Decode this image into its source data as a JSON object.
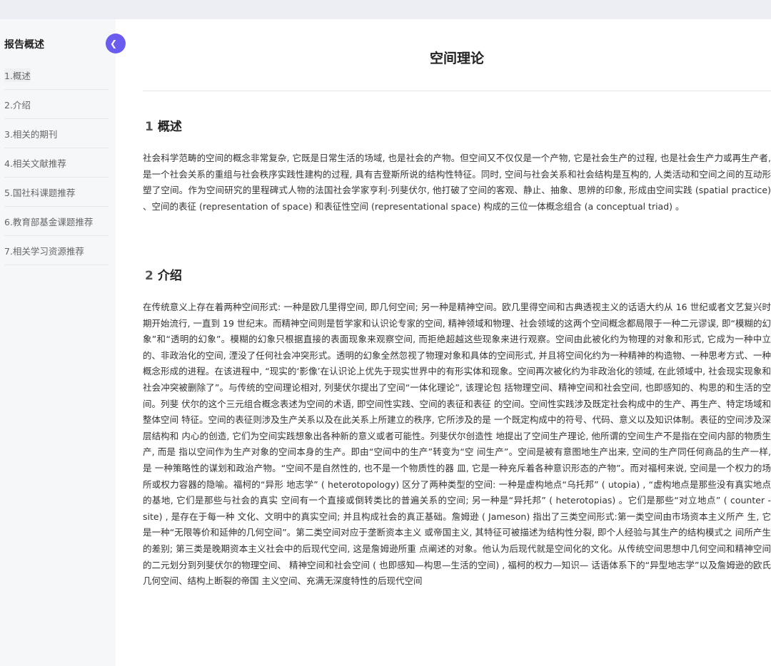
{
  "sidebar": {
    "title": "报告概述",
    "collapse_icon": "chevron-left-icon",
    "items": [
      {
        "label": "1.概述"
      },
      {
        "label": "2.介绍"
      },
      {
        "label": "3.相关的期刊"
      },
      {
        "label": "4.相关文献推荐"
      },
      {
        "label": "5.国社科课题推荐"
      },
      {
        "label": "6.教育部基金课题推荐"
      },
      {
        "label": "7.相关学习资源推荐"
      }
    ]
  },
  "main": {
    "title": "空间理论",
    "sections": [
      {
        "number": "1",
        "heading": "概述",
        "text": "社会科学范畴的空间的概念非常复杂, 它既是日常生活的场域, 也是社会的产物。但空间又不仅仅是一个产物, 它是社会生产的过程, 也是社会生产力或再生产者, 是一个社会关系的重组与社会秩序实践性建构的过程, 具有吉登斯所说的结构性特征。同时, 空间与社会关系和社会结构是互构的, 人类活动和空间之间的互动形塑了空间。作为空间研究的里程碑式人物的法国社会学家亨利·列斐伏尔, 他打破了空间的客观、静止、抽象、思辨的印象, 形成由空间实践 (spatial practice) 、空间的表征 (representation of space) 和表征性空间 (representational space) 构成的三位一体概念组合 (a conceptual triad) 。"
      },
      {
        "number": "2",
        "heading": "介绍",
        "text": "在传统意义上存在着两种空间形式: 一种是欧几里得空间, 即几何空间; 另一种是精神空间。欧几里得空间和古典透视主义的话语大约从 16 世纪或者文艺复兴时期开始流行, 一直到 19 世纪末。而精神空间则是哲学家和认识论专家的空间, 精神领域和物理、社会领域的这两个空间概念都局限于一种二元谬误, 即“模糊的幻象”和“透明的幻象”。模糊的幻象只根据直接的表面现象来观察空间, 而拒绝超越这些现象来进行观察。空间由此被化约为物理的对象和形式, 它成为一种中立的、非政治化的空间, 湮没了任何社会冲突形式。透明的幻象全然忽视了物理对象和具体的空间形式, 并且将空间化约为一种精神的构造物、一种思考方式、一种概念形成的进程。在该进程中, “现实的‘影像’在认识论上优先于现实世界中的有形实体和现象。空间再次被化约为非政治化的领域, 在此领域中, 社会现实现象和社会冲突被删除了”。与传统的空间理论相对, 列斐伏尔提出了空间“一体化理论”, 该理论包 括物理空间、精神空间和社会空间, 也即感知的、构思的和生活的空间。列斐 伏尔的这个三元组合概念表述为空间的术语, 即空间性实践、空间的表征和表征 的空间。空间性实践涉及既定社会构成中的生产、再生产、特定场域和整体空间 特征。空间的表征则涉及生产关系以及在此关系上所建立的秩序, 它所涉及的是 一个既定构成中的符号、代码、意义以及知识体制。表征的空间涉及深层结构和 内心的创造, 它们为空间实践想象出各种新的意义或者可能性。列斐伏尔创造性 地提出了空间生产理论, 他所谓的空间生产不是指在空间内部的物质生产, 而是 指以空间作为生产对象的空间本身的生产。即由“空间中的生产”转变为“空 间生产”。空间是被有意图地生产出来, 空间的生产同任何商品的生产一样, 是 一种策略性的谋划和政治产物。“空间不是自然性的, 也不是一个物质性的器 皿, 它是一种充斥着各种意识形态的产物”。而对福柯来说, 空间是一个权力的场所或权力容器的隐喻。福柯的“异形 地志学” ( heterotopology) 区分了两种类型的空间: 一种是虚构地点“乌托邦” ( utopia) , “虚构地点是那些没有真实地点的基地, 它们是那些与社会的真实 空间有一个直接或倒转类比的普遍关系的空间; 另一种是“异托邦” ( heterotopias) 。它们是那些“对立地点” ( counter - site) , 是存在于每一种 文化、文明中的真实空间; 并且构成社会的真正基础。詹姆逊 ( Jameson) 指出了三类空间形式:第一类空间由市场资本主义所产 生, 它是一种“无限等价和延伸的几何空间”。第二类空间对应于垄断资本主义 或帝国主义, 其特征可被描述为结构性分裂, 即个人经验与其生产的结构模式之 间所产生的差别; 第三类是晚期资本主义社会中的后现代空间, 这是詹姆逊所重 点阐述的对象。他认为后现代就是空间化的文化。从传统空间思想中几何空间和精神空间的二元划分到列斐伏尔的物理空间、 精神空间和社会空间 ( 也即感知—构思—生活的空间) , 福柯的权力—知识— 话语体系下的“异型地志学”以及詹姆逊的欧氏几何空间、结构上断裂的帝国 主义空间、充满无深度特性的后现代空间"
      }
    ]
  }
}
